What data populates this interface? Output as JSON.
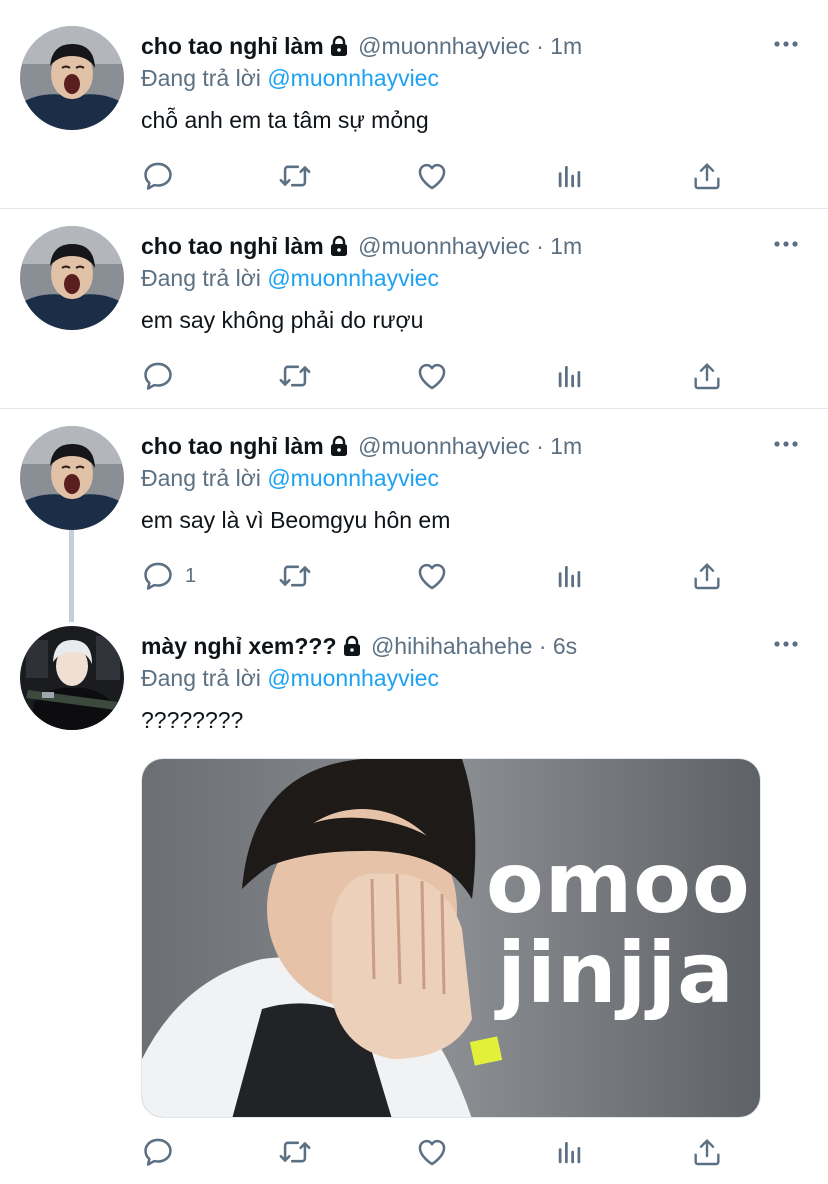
{
  "replying_label": "Đang trả lời",
  "tweets": [
    {
      "name": "cho tao nghỉ làm",
      "handle": "@muonnhayviec",
      "separator": "·",
      "time": "1m",
      "reply_to": "@muonnhayviec",
      "text": "chỗ anh em ta tâm sự mỏng",
      "reply_count": ""
    },
    {
      "name": "cho tao nghỉ làm",
      "handle": "@muonnhayviec",
      "separator": "·",
      "time": "1m",
      "reply_to": "@muonnhayviec",
      "text": "em say không phải do rượu",
      "reply_count": ""
    },
    {
      "name": "cho tao nghỉ làm",
      "handle": "@muonnhayviec",
      "separator": "·",
      "time": "1m",
      "reply_to": "@muonnhayviec",
      "text": "em say là vì Beomgyu hôn em",
      "reply_count": "1"
    },
    {
      "name": "mày nghỉ xem???",
      "handle": "@hihihahahehe",
      "separator": "·",
      "time": "6s",
      "reply_to": "@muonnhayviec",
      "text": "????????",
      "reply_count": "",
      "media": {
        "line1": "omoo",
        "line2": "jinjja"
      }
    }
  ],
  "icons": [
    "reply-icon",
    "retweet-icon",
    "like-icon",
    "analytics-icon",
    "share-icon",
    "more-icon",
    "lock-icon"
  ],
  "colors": {
    "link": "#1da1f2",
    "secondary_text": "#5b7083",
    "divider": "#e1e8ed",
    "thread_line": "#c4cfd6"
  }
}
